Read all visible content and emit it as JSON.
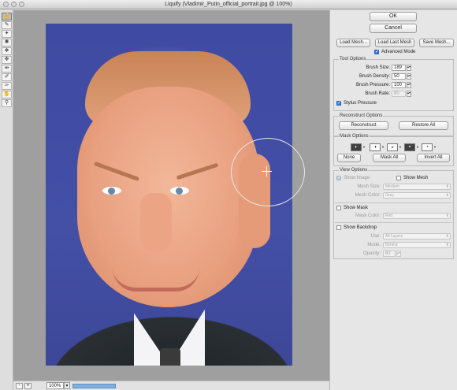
{
  "window": {
    "title": "Liquify (Vladimir_Putin_official_portrait.jpg @ 100%)"
  },
  "tools": [
    {
      "name": "forward-warp-tool",
      "glyph": "☝"
    },
    {
      "name": "reconstruct-tool",
      "glyph": "✎"
    },
    {
      "name": "smooth-tool",
      "glyph": "✦"
    },
    {
      "name": "twirl-tool",
      "glyph": "✺"
    },
    {
      "name": "pucker-tool",
      "glyph": "❖"
    },
    {
      "name": "bloat-tool",
      "glyph": "✥"
    },
    {
      "name": "push-left-tool",
      "glyph": "⇹"
    },
    {
      "name": "freeze-mask-tool",
      "glyph": "✐"
    },
    {
      "name": "thaw-mask-tool",
      "glyph": "✑"
    },
    {
      "name": "hand-tool",
      "glyph": "✋"
    },
    {
      "name": "zoom-tool",
      "glyph": "⚲"
    }
  ],
  "status": {
    "zoom_out": "-",
    "zoom_in": "+",
    "zoom": "100%",
    "progress": 0.43
  },
  "buttons": {
    "ok": "OK",
    "cancel": "Cancel",
    "load_mesh": "Load Mesh...",
    "load_last_mesh": "Load Last Mesh",
    "save_mesh": "Save Mesh..."
  },
  "advanced_mode": {
    "label": "Advanced Mode",
    "checked": true
  },
  "tool_options": {
    "title": "Tool Options",
    "brush_size": {
      "label": "Brush Size:",
      "value": "189"
    },
    "brush_density": {
      "label": "Brush Density:",
      "value": "50"
    },
    "brush_pressure": {
      "label": "Brush Pressure:",
      "value": "100"
    },
    "brush_rate": {
      "label": "Brush Rate:",
      "value": "80"
    },
    "stylus_pressure": {
      "label": "Stylus Pressure",
      "checked": true
    }
  },
  "reconstruct_options": {
    "title": "Reconstruct Options",
    "reconstruct": "Reconstruct",
    "restore_all": "Restore All"
  },
  "mask_options": {
    "title": "Mask Options",
    "none": "None",
    "mask_all": "Mask All",
    "invert_all": "Invert All"
  },
  "view_options": {
    "title": "View Options",
    "show_image": "Show Image",
    "show_mesh": "Show Mesh",
    "mesh_size": {
      "label": "Mesh Size:",
      "value": "Medium"
    },
    "mesh_color": {
      "label": "Mesh Color:",
      "value": "Gray"
    },
    "show_mask": "Show Mask",
    "mask_color": {
      "label": "Mask Color:",
      "value": "Red"
    },
    "show_backdrop": "Show Backdrop",
    "use": {
      "label": "Use:",
      "value": "All Layers"
    },
    "mode": {
      "label": "Mode:",
      "value": "Behind"
    },
    "opacity": {
      "label": "Opacity:",
      "value": "62"
    }
  },
  "colors": {
    "brush_circle": "#e7e7e7",
    "progress": "#7fb0e0",
    "backdrop": "#9f9f9f"
  }
}
